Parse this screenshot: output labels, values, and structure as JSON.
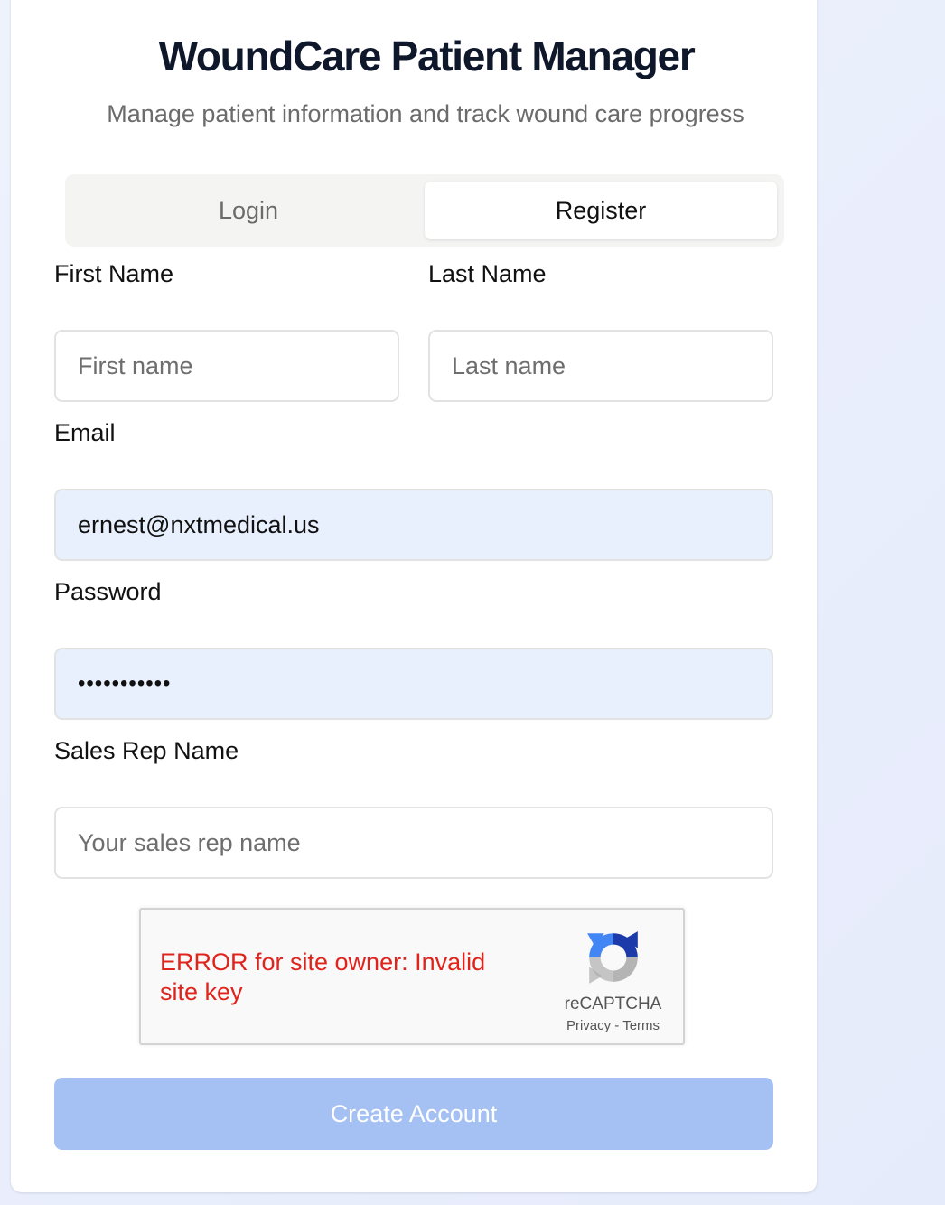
{
  "header": {
    "title": "WoundCare Patient Manager",
    "subtitle": "Manage patient information and track wound care progress"
  },
  "tabs": [
    {
      "label": "Login",
      "active": false
    },
    {
      "label": "Register",
      "active": true
    }
  ],
  "form": {
    "first_name": {
      "label": "First Name",
      "placeholder": "First name",
      "value": ""
    },
    "last_name": {
      "label": "Last Name",
      "placeholder": "Last name",
      "value": ""
    },
    "email": {
      "label": "Email",
      "value": "ernest@nxtmedical.us"
    },
    "password": {
      "label": "Password",
      "masked_value": "•••••••••••"
    },
    "sales_rep": {
      "label": "Sales Rep Name",
      "placeholder": "Your sales rep name",
      "value": ""
    }
  },
  "recaptcha": {
    "error": "ERROR for site owner: Invalid site key",
    "brand": "reCAPTCHA",
    "privacy": "Privacy",
    "separator": "-",
    "terms": "Terms",
    "icon": "recaptcha-logo"
  },
  "submit_label": "Create Account",
  "colors": {
    "autofill_bg": "#e8effd",
    "submit_disabled": "#a5c0f3",
    "error_text": "#e0231b",
    "active_tab_bg": "#ffffff",
    "tab_track_bg": "#f4f4f3"
  }
}
